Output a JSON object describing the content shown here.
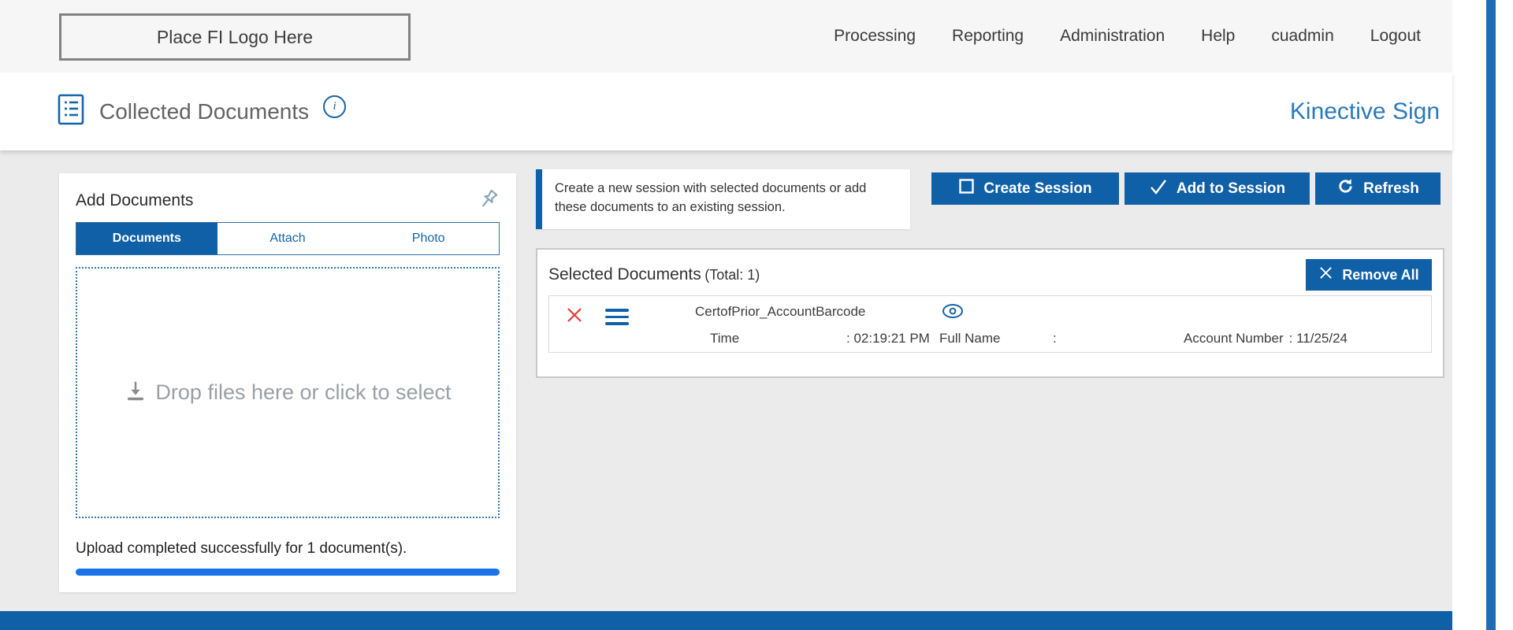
{
  "navbar": {
    "logo_text": "Place FI Logo Here",
    "links": [
      "Processing",
      "Reporting",
      "Administration",
      "Help",
      "cuadmin",
      "Logout"
    ]
  },
  "header": {
    "title": "Collected Documents",
    "brand": "Kinective Sign"
  },
  "add_documents": {
    "title": "Add Documents",
    "tabs": [
      "Documents",
      "Attach",
      "Photo"
    ],
    "active_tab": "Documents",
    "dropzone_text": "Drop files here or click to select",
    "status_text": "Upload completed successfully for 1 document(s).",
    "progress_percent": 100
  },
  "session_actions": {
    "info_text": "Create a new session with selected documents or add these documents to an existing session.",
    "create_label": "Create Session",
    "add_label": "Add to Session",
    "refresh_label": "Refresh"
  },
  "selected_documents": {
    "title": "Selected Documents",
    "total_label": "(Total: 1)",
    "remove_all_label": "Remove All",
    "rows": [
      {
        "name": "CertofPrior_AccountBarcode",
        "time_label": "Time",
        "time_value": ": 02:19:21 PM",
        "fullname_label": "Full Name",
        "fullname_value": ":",
        "account_label": "Account Number",
        "account_value": ": 11/25/24"
      }
    ]
  },
  "colors": {
    "primary": "#1060a7",
    "brand_blue": "#2a79bd",
    "progress_blue": "#1b72e8",
    "danger_red": "#e23b3b"
  }
}
